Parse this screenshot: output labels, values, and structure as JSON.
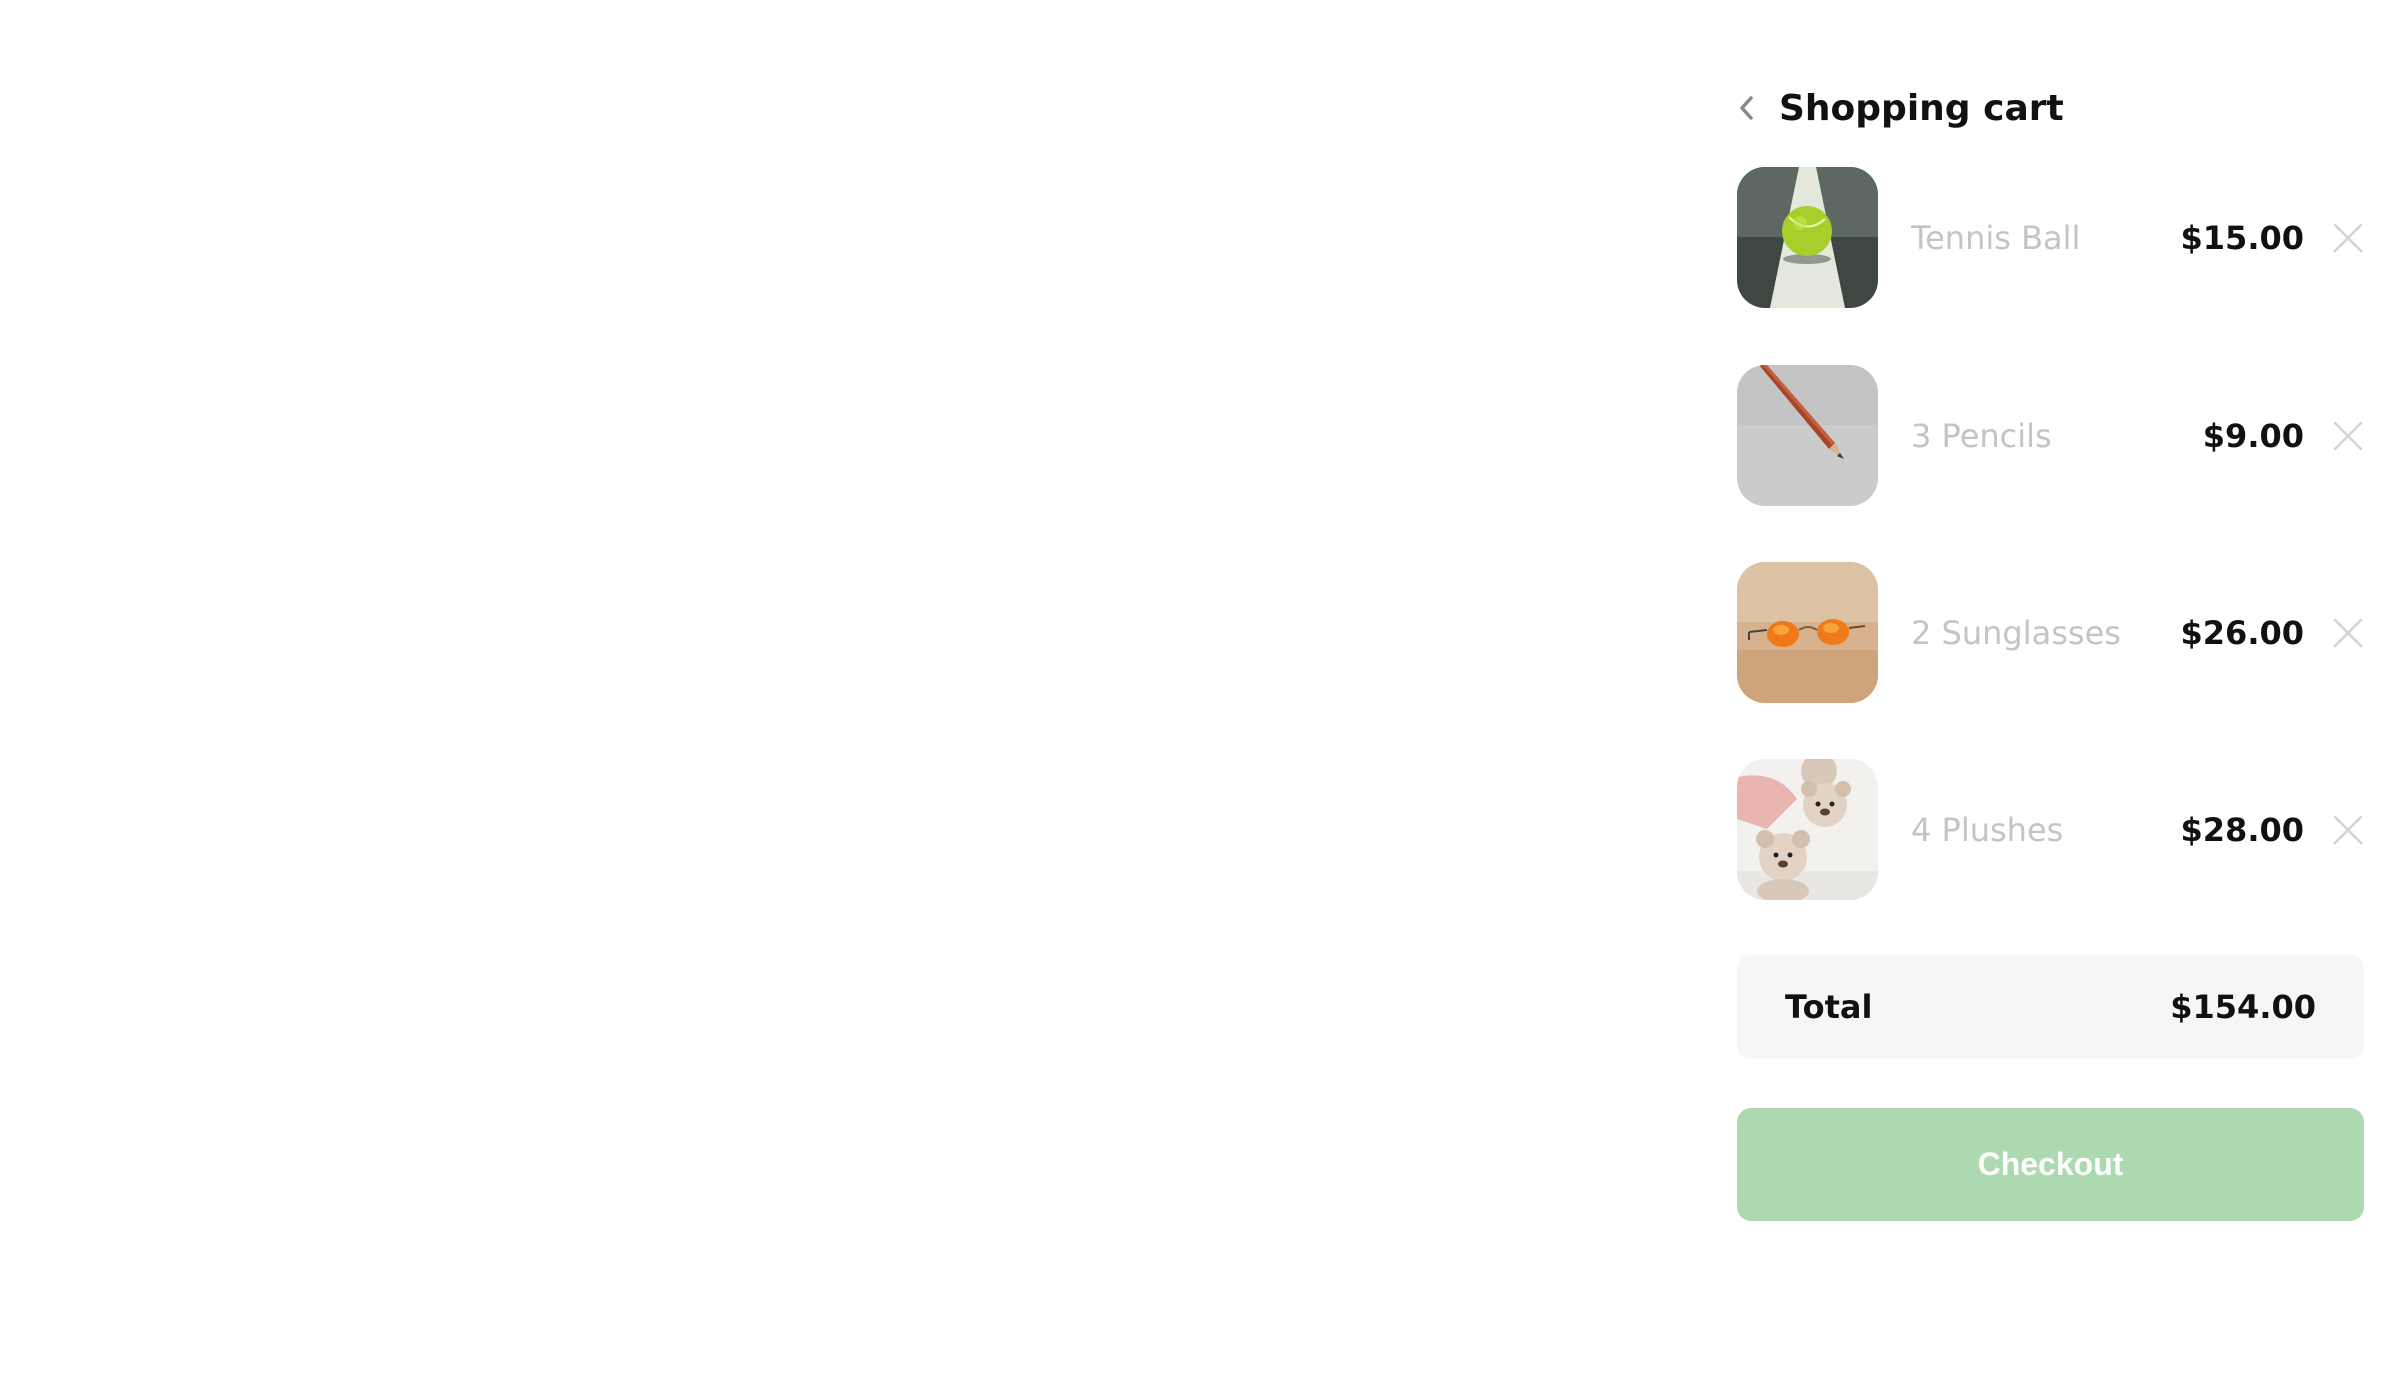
{
  "header": {
    "title": "Shopping cart",
    "back_icon": "chevron-left-icon"
  },
  "items": [
    {
      "name": "Tennis Ball",
      "price": "$15.00",
      "image": "tennis-ball-photo",
      "remove_icon": "close-icon"
    },
    {
      "name": "3 Pencils",
      "price": "$9.00",
      "image": "pencil-photo",
      "remove_icon": "close-icon"
    },
    {
      "name": "2 Sunglasses",
      "price": "$26.00",
      "image": "sunglasses-photo",
      "remove_icon": "close-icon"
    },
    {
      "name": "4 Plushes",
      "price": "$28.00",
      "image": "plush-toys-photo",
      "remove_icon": "close-icon"
    }
  ],
  "total": {
    "label": "Total",
    "value": "$154.00"
  },
  "checkout": {
    "label": "Checkout"
  },
  "colors": {
    "checkout_bg": "#acd9b0",
    "item_name_text": "#c4c4c4",
    "total_bg": "#f6f6f6",
    "remove_icon": "#d4d4d4"
  }
}
